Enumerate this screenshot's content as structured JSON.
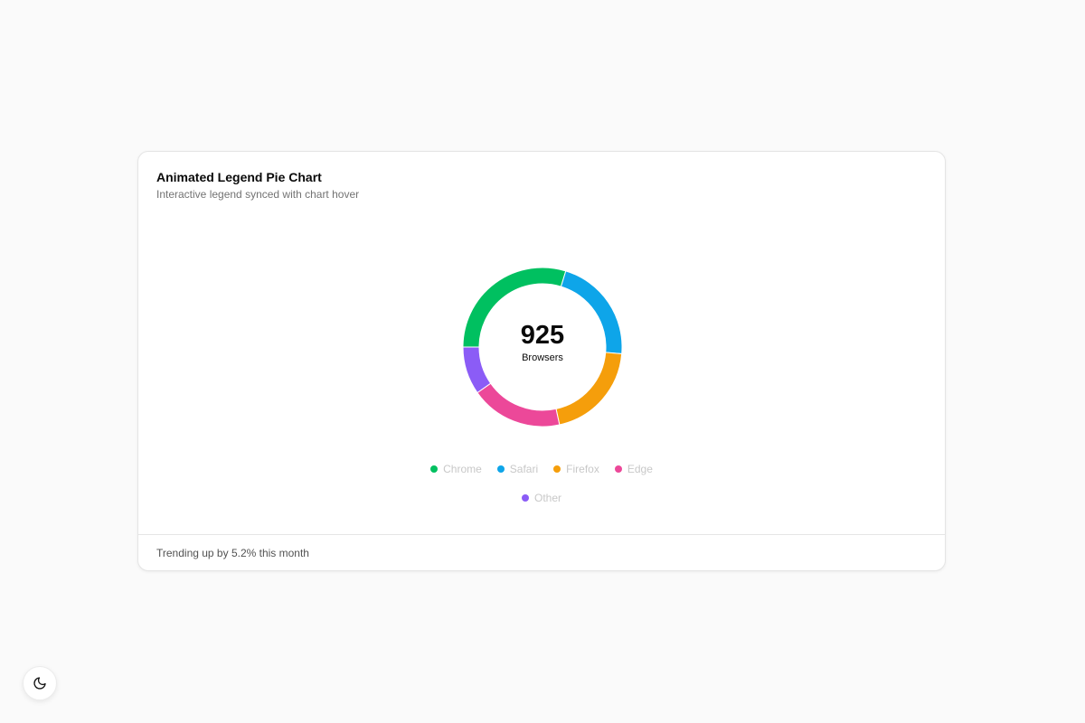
{
  "card": {
    "title": "Animated Legend Pie Chart",
    "subtitle": "Interactive legend synced with chart hover",
    "footer": "Trending up by 5.2% this month"
  },
  "chart_data": {
    "type": "pie",
    "variant": "donut",
    "title": "Animated Legend Pie Chart",
    "subtitle": "Interactive legend synced with chart hover",
    "center_value": "925",
    "center_label": "Browsers",
    "total": 925,
    "slices": [
      {
        "name": "Chrome",
        "value": 275,
        "color": "#00c060"
      },
      {
        "name": "Safari",
        "value": 200,
        "color": "#0ea5e9"
      },
      {
        "name": "Firefox",
        "value": 187,
        "color": "#f59e0b"
      },
      {
        "name": "Edge",
        "value": 173,
        "color": "#ec4899"
      },
      {
        "name": "Other",
        "value": 90,
        "color": "#8b5cf6"
      }
    ],
    "legend": {
      "placement": "bottom",
      "rows": [
        [
          "Chrome",
          "Safari",
          "Firefox",
          "Edge"
        ],
        [
          "Other"
        ]
      ]
    }
  },
  "theme_toggle": {
    "icon": "moon-icon"
  }
}
